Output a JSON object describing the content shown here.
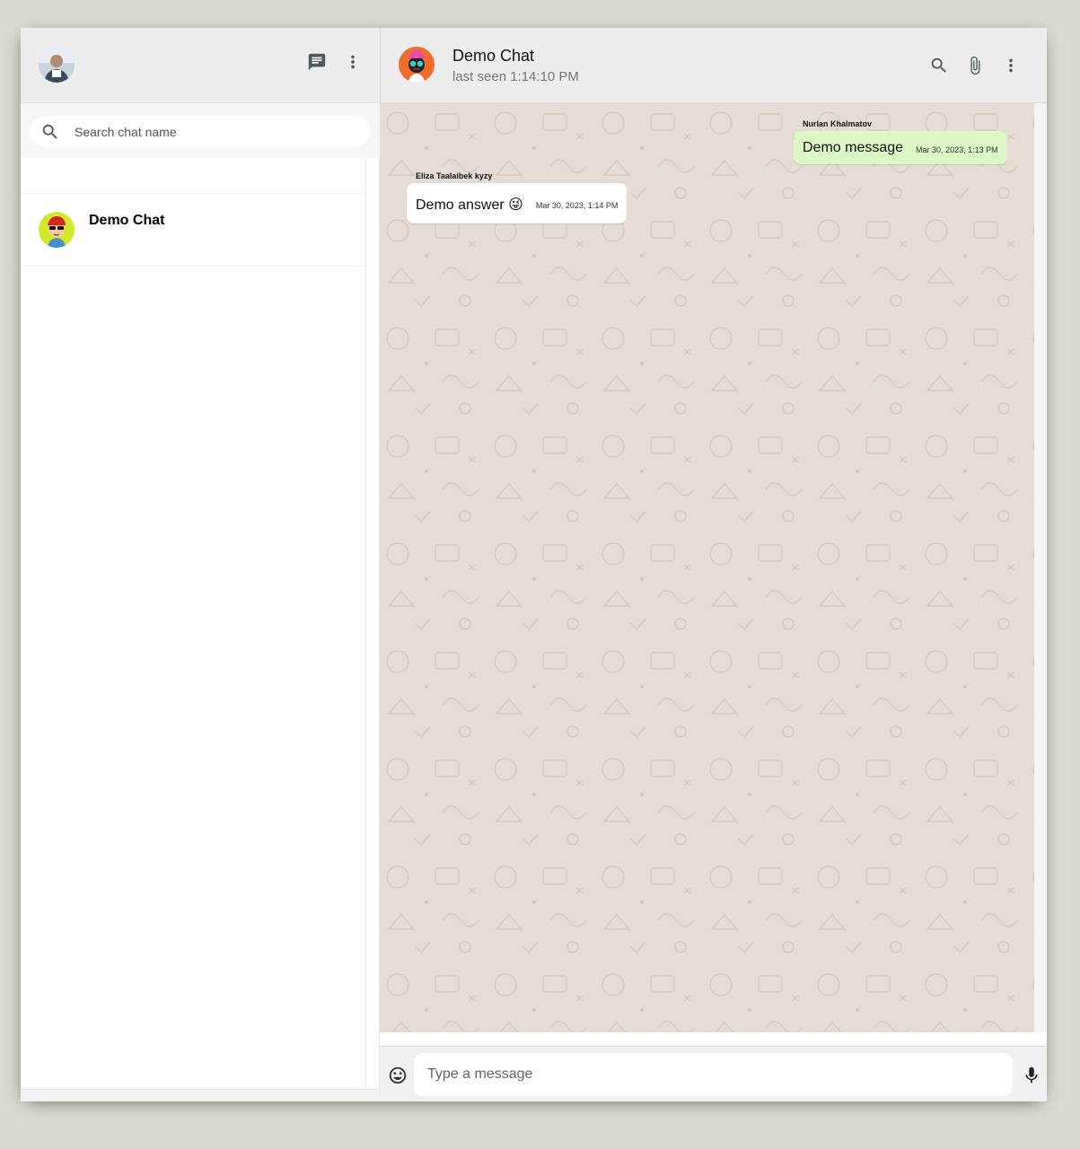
{
  "sidebar": {
    "header": {
      "avatar_icon": "user-avatar",
      "icons": [
        "chat-icon",
        "more-vert-icon"
      ]
    },
    "search": {
      "placeholder": "Search chat name",
      "value": ""
    },
    "chats": [
      {
        "name": "Demo Chat",
        "avatar_icon": "cartoon-avatar"
      }
    ]
  },
  "chat": {
    "header": {
      "title": "Demo Chat",
      "subtitle": "last seen 1:14:10 PM",
      "icons": [
        "search-icon",
        "attach-icon",
        "more-vert-icon"
      ]
    },
    "messages": [
      {
        "sender": "Nurlan Khalmatov",
        "text": "Demo message",
        "timestamp": "Mar 30, 2023, 1:13 PM",
        "direction": "outgoing"
      },
      {
        "sender": "Eliza Taalaibek kyzy",
        "text": "Demo answer 😜",
        "timestamp": "Mar 30, 2023, 1:14 PM",
        "direction": "incoming"
      }
    ],
    "footer": {
      "placeholder": "Type a message",
      "value": "",
      "icons": [
        "emoji-icon",
        "mic-icon"
      ]
    }
  },
  "colors": {
    "background": "#dadbd3",
    "header": "#ededed",
    "chat_wallpaper": "#e5ddd5",
    "outgoing_bubble": "#dcf8c6",
    "incoming_bubble": "#ffffff"
  }
}
